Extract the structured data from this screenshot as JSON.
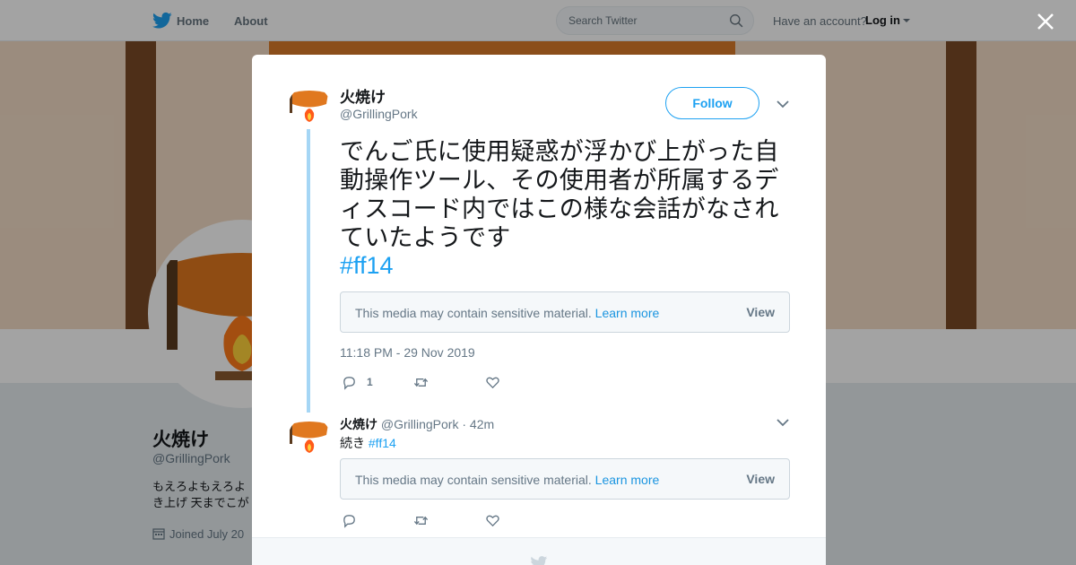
{
  "nav": {
    "home": "Home",
    "about": "About",
    "search_placeholder": "Search Twitter",
    "have_account": "Have an account?",
    "login": "Log in"
  },
  "profile": {
    "name": "火焼け",
    "handle": "@GrillingPork",
    "bio_line1": "もえろよもえろよ",
    "bio_line2": "き上げ 天までこが",
    "joined": "Joined July 20"
  },
  "tweet1": {
    "name": "火焼け",
    "handle": "@GrillingPork",
    "follow_label": "Follow",
    "text": "でんご氏に使用疑惑が浮かび上がった自動操作ツール、その使用者が所属するディスコード内ではこの様な会話がなされていたようです",
    "hashtag": "#ff14",
    "sensitive_text": "This media may contain sensitive material.",
    "learn_more": "Learn more",
    "view": "View",
    "timestamp": "11:18 PM - 29 Nov 2019",
    "reply_count": "1"
  },
  "tweet2": {
    "name": "火焼け",
    "handle": "@GrillingPork",
    "age": "· 42m",
    "text": "続き",
    "hashtag": "#ff14",
    "sensitive_text": "This media may contain sensitive material.",
    "learn_more": "Learn more",
    "view": "View"
  },
  "icons": {
    "logo": "twitter-bird-icon",
    "search": "search-icon",
    "close": "close-icon",
    "reply": "reply-icon",
    "retweet": "retweet-icon",
    "like": "heart-icon",
    "menu": "chevron-down-icon",
    "calendar": "calendar-icon"
  },
  "colors": {
    "brand": "#1da1f2",
    "text": "#14171a",
    "secondary": "#657786",
    "thread_line": "#a5d6f5"
  }
}
